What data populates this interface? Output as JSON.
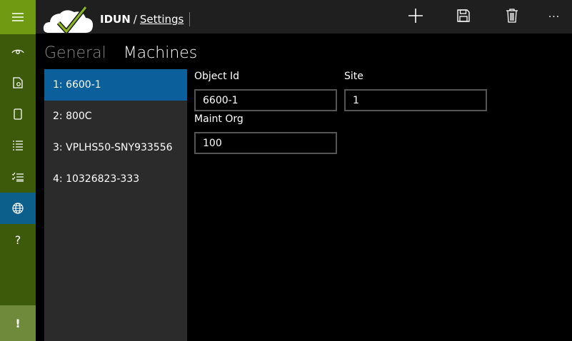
{
  "header": {
    "app_name": "IDUN",
    "separator": "/",
    "breadcrumb": "Settings"
  },
  "toolbar": {
    "add_icon": "plus-icon",
    "save_icon": "floppy-disk-icon",
    "delete_icon": "trash-icon",
    "more_label": "···"
  },
  "sidebar": {
    "items": [
      {
        "icon": "hamburger-icon"
      },
      {
        "icon": "eye-icon"
      },
      {
        "icon": "document-icon"
      },
      {
        "icon": "page-icon"
      },
      {
        "icon": "list-icon"
      },
      {
        "icon": "checklist-icon"
      },
      {
        "icon": "globe-icon",
        "active": true
      },
      {
        "icon": "help-icon",
        "label": "?"
      }
    ],
    "warning_label": "!"
  },
  "tabs": [
    {
      "label": "General",
      "active": false
    },
    {
      "label": "Machines",
      "active": true
    }
  ],
  "machines": [
    {
      "label": "1: 6600-1",
      "selected": true
    },
    {
      "label": "2: 800C"
    },
    {
      "label": "3: VPLHS50-SNY933556"
    },
    {
      "label": "4: 10326823-333"
    }
  ],
  "form": {
    "object_id_label": "Object Id",
    "object_id_value": "6600-1",
    "site_label": "Site",
    "site_value": "1",
    "maint_org_label": "Maint Org",
    "maint_org_value": "100"
  },
  "colors": {
    "rail": "#3c5a0a",
    "rail_header": "#6f9a12",
    "accent": "#0b5f9a",
    "topbar": "#1f1f1f"
  }
}
